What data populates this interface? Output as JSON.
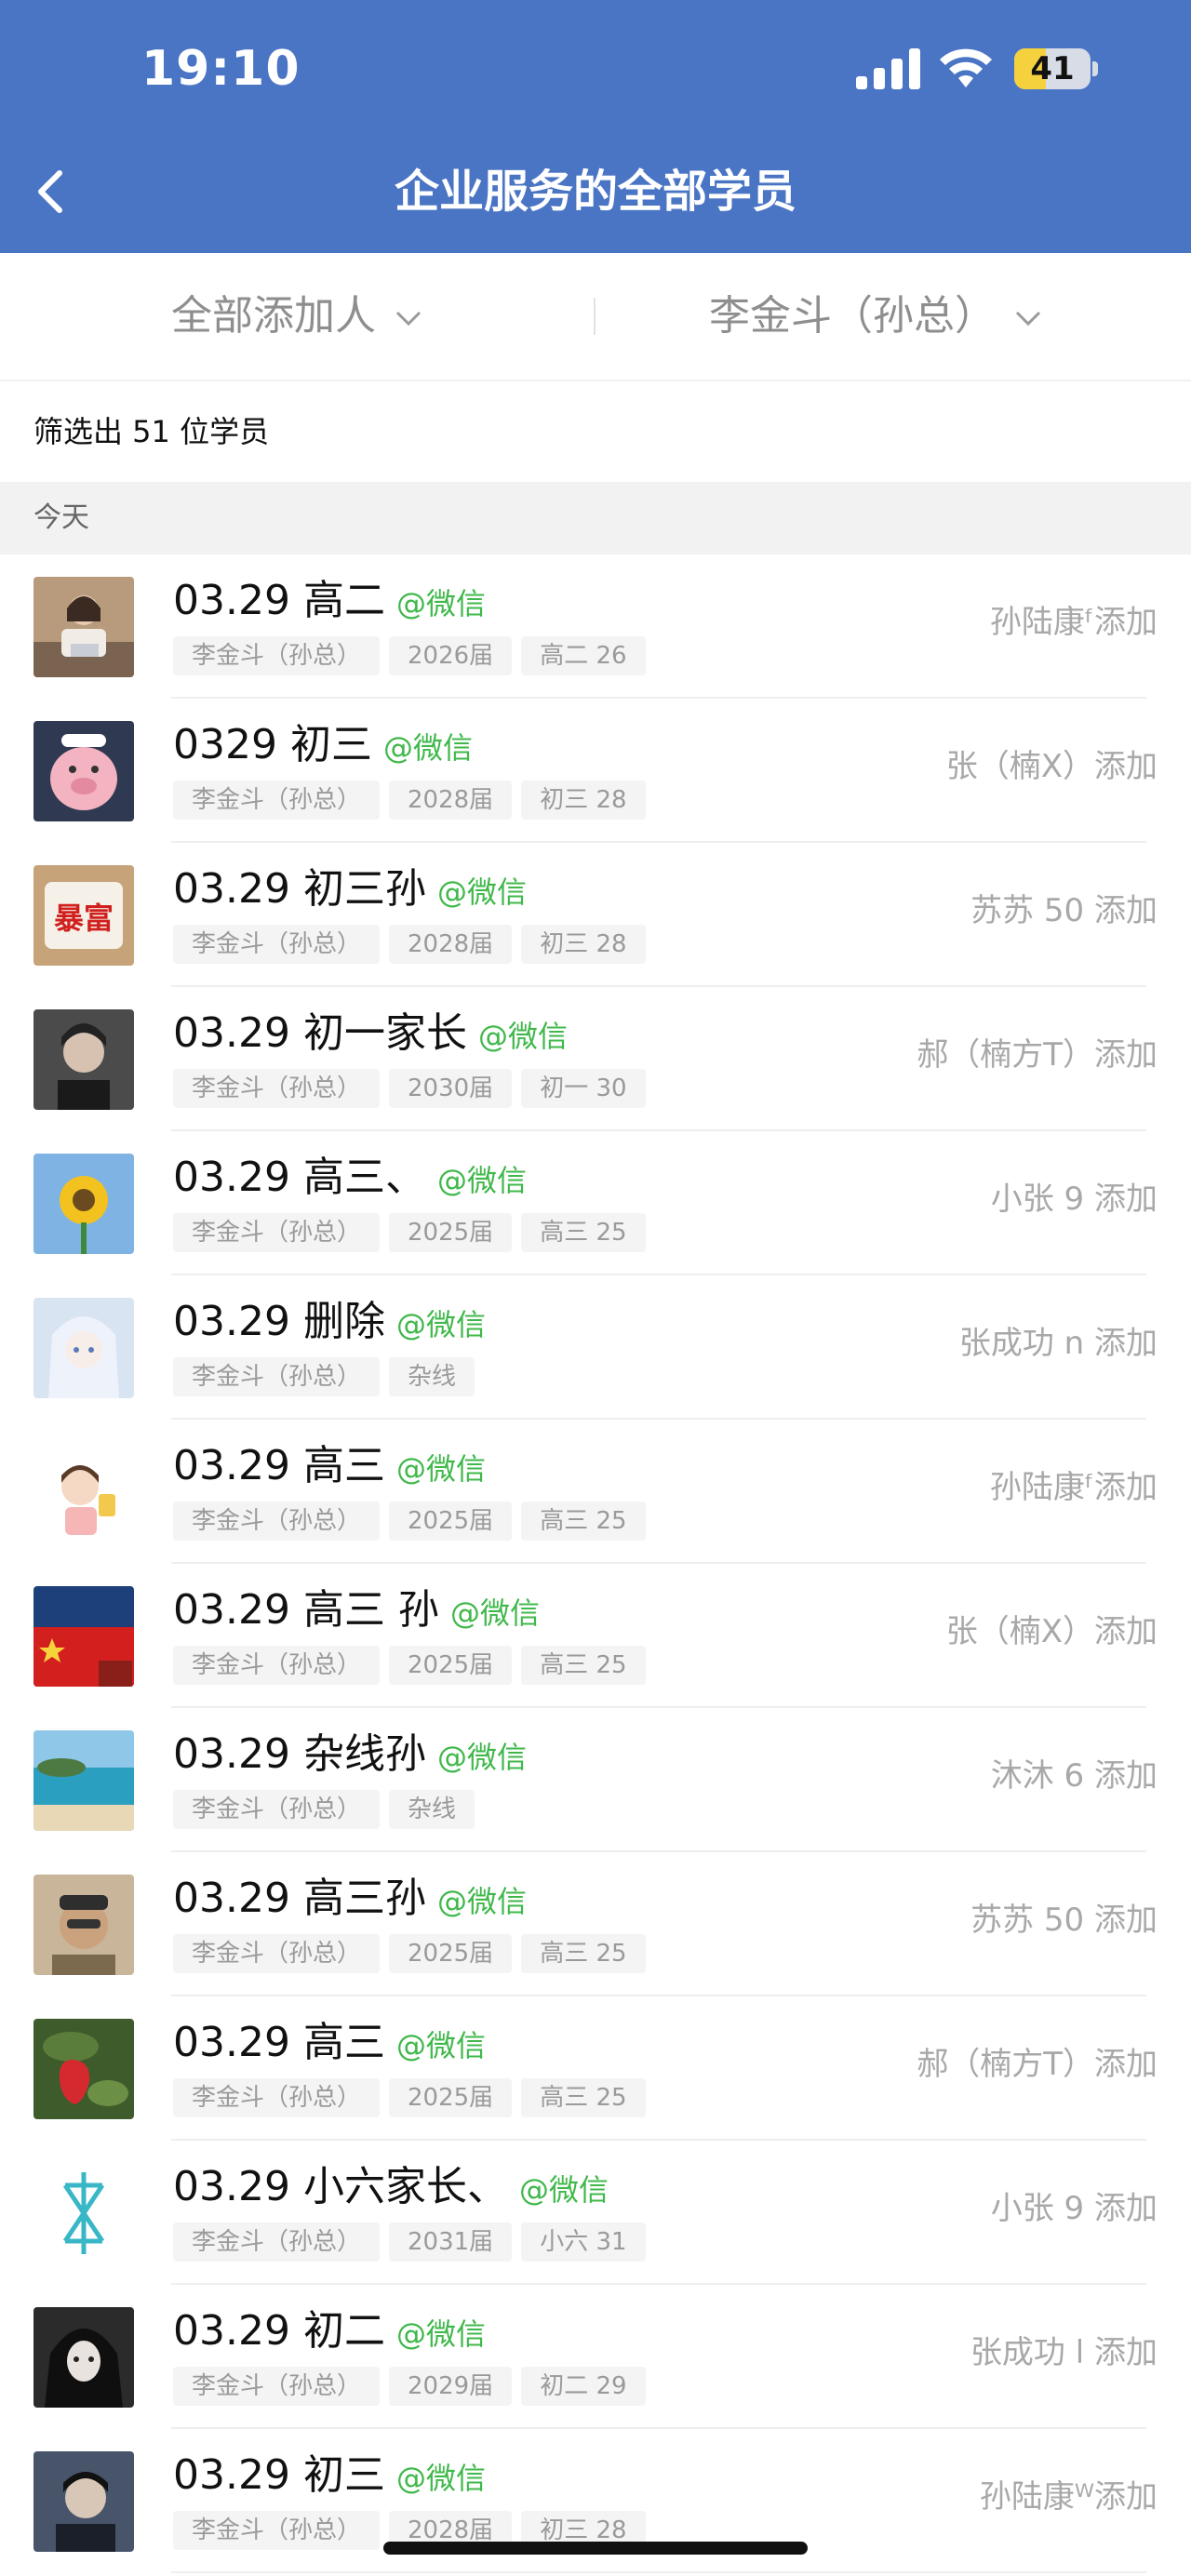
{
  "status_bar": {
    "time": "19:10",
    "battery": "41",
    "battery_level": 0.41
  },
  "header": {
    "title": "企业服务的全部学员",
    "back_icon": "chevron-left-icon"
  },
  "filters": [
    {
      "label": "全部添加人",
      "icon": "chevron-down-icon"
    },
    {
      "label": "李金斗（孙总）",
      "icon": "chevron-down-icon"
    }
  ],
  "summary": {
    "text": "筛选出 51 位学员"
  },
  "section": {
    "label": "今天"
  },
  "colors": {
    "accent": "#4a75c4",
    "wechat_green": "#3fb84a",
    "muted": "#a8a8a8"
  },
  "students": [
    {
      "name": "03.29 高二",
      "source": "@微信",
      "tags": [
        "李金斗（孙总）",
        "2026届",
        "高二 26"
      ],
      "added_by": "孙陆康ᶠ添加",
      "avatar": "photo-woman-laptop"
    },
    {
      "name": "0329 初三",
      "source": "@微信",
      "tags": [
        "李金斗（孙总）",
        "2028届",
        "初三 28"
      ],
      "added_by": "张（楠X）添加",
      "avatar": "pink-pig-cartoon"
    },
    {
      "name": "03.29 初三孙",
      "source": "@微信",
      "tags": [
        "李金斗（孙总）",
        "2028届",
        "初三 28"
      ],
      "added_by": "苏苏 50 添加",
      "avatar": "red-sign-暴富"
    },
    {
      "name": "03.29 初一家长",
      "source": "@微信",
      "tags": [
        "李金斗（孙总）",
        "2030届",
        "初一 30"
      ],
      "added_by": "郝（楠方T）添加",
      "avatar": "dark-portrait"
    },
    {
      "name": "03.29 高三、",
      "source": "@微信",
      "tags": [
        "李金斗（孙总）",
        "2025届",
        "高三 25"
      ],
      "added_by": "小张 9 添加",
      "avatar": "sunflower"
    },
    {
      "name": "03.29 删除",
      "source": "@微信",
      "tags": [
        "李金斗（孙总）",
        "杂线"
      ],
      "added_by": "张成功 n 添加",
      "avatar": "anime-girl"
    },
    {
      "name": "03.29  高三",
      "source": "@微信",
      "tags": [
        "李金斗（孙总）",
        "2025届",
        "高三 25"
      ],
      "added_by": "孙陆康ᶠ添加",
      "avatar": "cartoon-girl"
    },
    {
      "name": "03.29 高三  孙",
      "source": "@微信",
      "tags": [
        "李金斗（孙总）",
        "2025届",
        "高三 25"
      ],
      "added_by": "张（楠X）添加",
      "avatar": "china-flag"
    },
    {
      "name": "03.29 杂线孙",
      "source": "@微信",
      "tags": [
        "李金斗（孙总）",
        "杂线"
      ],
      "added_by": "沐沐 6 添加",
      "avatar": "sea-beach"
    },
    {
      "name": "03.29 高三孙",
      "source": "@微信",
      "tags": [
        "李金斗（孙总）",
        "2025届",
        "高三 25"
      ],
      "added_by": "苏苏 50 添加",
      "avatar": "man-selfie"
    },
    {
      "name": "03.29 高三",
      "source": "@微信",
      "tags": [
        "李金斗（孙总）",
        "2025届",
        "高三 25"
      ],
      "added_by": "郝（楠方T）添加",
      "avatar": "strawberry"
    },
    {
      "name": "03.29 小六家长、",
      "source": "@微信",
      "tags": [
        "李金斗（孙总）",
        "2031届",
        "小六 31"
      ],
      "added_by": "小张 9 添加",
      "avatar": "teal-symbol"
    },
    {
      "name": "03.29 初二",
      "source": "@微信",
      "tags": [
        "李金斗（孙总）",
        "2029届",
        "初二 29"
      ],
      "added_by": "张成功 l 添加",
      "avatar": "dark-anime-girl"
    },
    {
      "name": "03.29  初三",
      "source": "@微信",
      "tags": [
        "李金斗（孙总）",
        "2028届",
        "初三 28"
      ],
      "added_by": "孙陆康ᵂ添加",
      "avatar": "dark-boy"
    }
  ]
}
